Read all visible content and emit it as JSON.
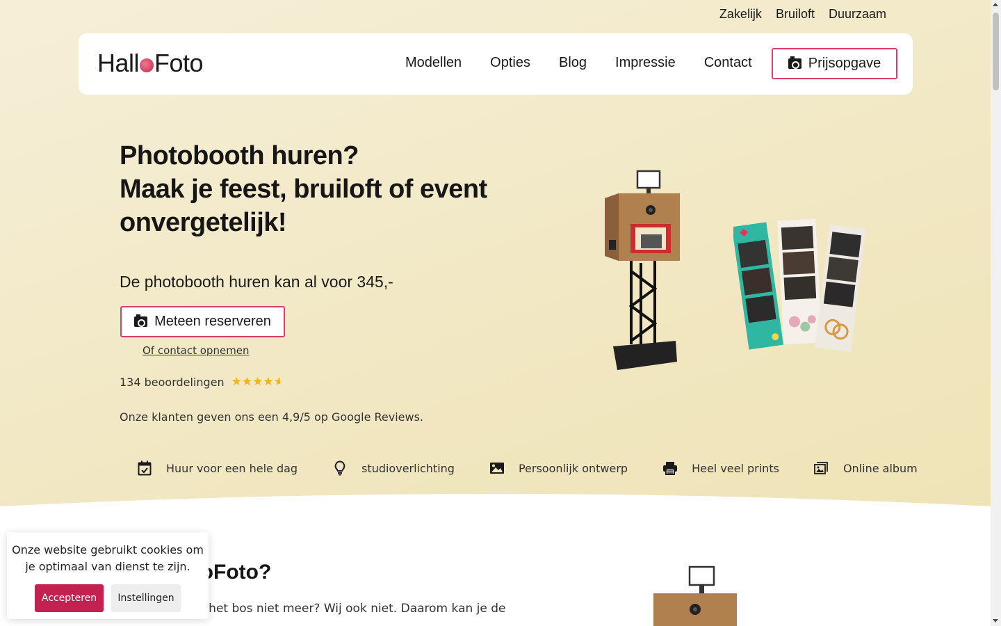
{
  "topnav": [
    "Zakelijk",
    "Bruiloft",
    "Duurzaam"
  ],
  "logo": {
    "left": "Hall",
    "right": "Foto"
  },
  "mainnav": [
    "Modellen",
    "Opties",
    "Blog",
    "Impressie",
    "Contact"
  ],
  "quote_button": "Prijsopgave",
  "hero": {
    "title_line1": "Photobooth huren?",
    "title_line2": "Maak je feest, bruiloft of event",
    "title_line3": "onvergetelijk!",
    "price": "De photobooth huren kan al voor 345,-",
    "reserve_button": "Meteen reserveren",
    "contact_link": "Of contact opnemen",
    "reviews_text": "134 beoordelingen",
    "rating": 4.6,
    "google_text": "Onze klanten geven ons een 4,9/5 op Google Reviews."
  },
  "features": [
    {
      "icon": "calendar-check-icon",
      "label": "Huur voor een hele dag"
    },
    {
      "icon": "lightbulb-icon",
      "label": "studioverlichting"
    },
    {
      "icon": "image-icon",
      "label": "Persoonlijk ontwerp"
    },
    {
      "icon": "printer-icon",
      "label": "Heel veel prints"
    },
    {
      "icon": "album-icon",
      "label": "Online album"
    }
  ],
  "section2": {
    "title": "lloFoto?",
    "text": "n het bos niet meer? Wij ook niet. Daarom kan je de"
  },
  "cookie": {
    "message": "Onze website gebruikt cookies om je optimaal van dienst te zijn.",
    "accept": "Accepteren",
    "settings": "Instellingen"
  },
  "colors": {
    "accent": "#d8416a",
    "accept_bg": "#c32150",
    "hero_bg": "#f1e7c2",
    "star": "#f1b21a"
  }
}
